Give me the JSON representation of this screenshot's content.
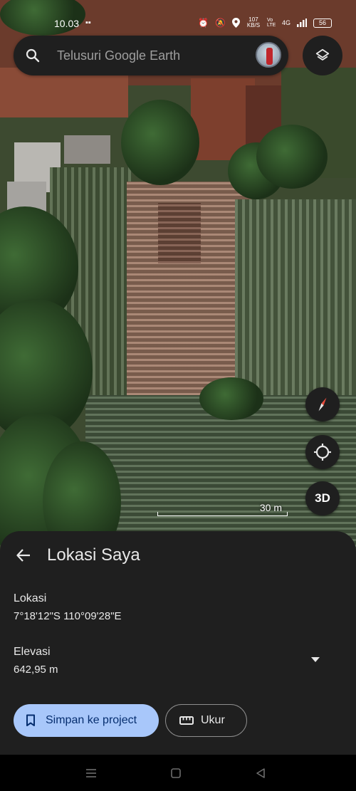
{
  "status_bar": {
    "time": "10.03",
    "net_speed": "107 KB/S",
    "net_type": "Vo LTE",
    "signal": "4G",
    "battery": "56"
  },
  "search": {
    "placeholder": "Telusuri Google Earth",
    "icon": "search-icon"
  },
  "map": {
    "scale_label": "30 m",
    "controls": {
      "compass": "compass-icon",
      "locate": "my-location-icon",
      "three_d_label": "3D"
    },
    "layers_icon": "layers-icon"
  },
  "sheet": {
    "title": "Lokasi Saya",
    "location_label": "Lokasi",
    "location_value": "7°18'12\"S 110°09'28\"E",
    "elevation_label": "Elevasi",
    "elevation_value": "642,95 m",
    "save_button_label": "Simpan ke project",
    "measure_button_label": "Ukur"
  },
  "colors": {
    "sheet_bg": "#1f1f1f",
    "primary_button_bg": "#a8c7fa",
    "primary_button_text": "#062e6f"
  }
}
